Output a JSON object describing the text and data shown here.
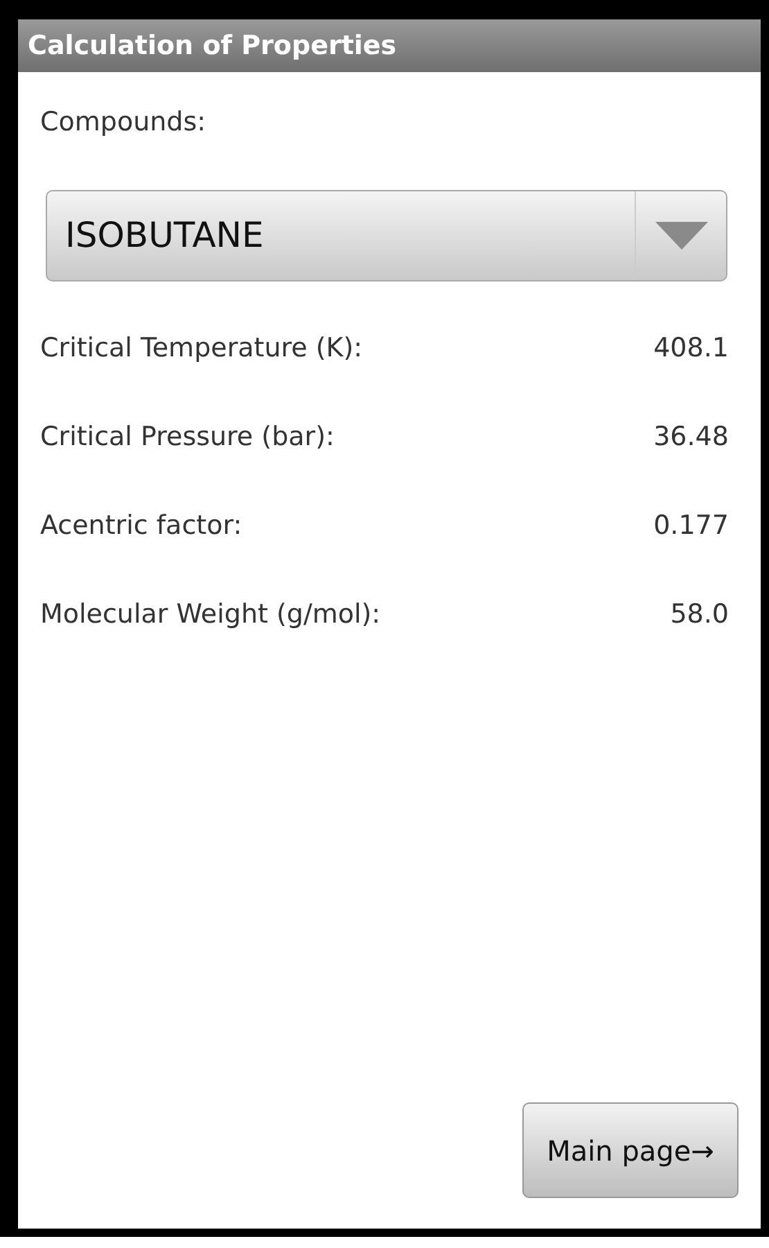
{
  "window": {
    "title": "Calculation of Properties"
  },
  "compounds": {
    "label": "Compounds:",
    "value": "ISOBUTANE"
  },
  "properties": [
    {
      "label": "Critical Temperature (K):",
      "value": "408.1"
    },
    {
      "label": "Critical Pressure (bar):",
      "value": "36.48"
    },
    {
      "label": "Acentric factor:",
      "value": "0.177"
    },
    {
      "label": "Molecular Weight (g/mol):",
      "value": "58.0"
    }
  ],
  "main_button": {
    "label": "Main page→"
  }
}
